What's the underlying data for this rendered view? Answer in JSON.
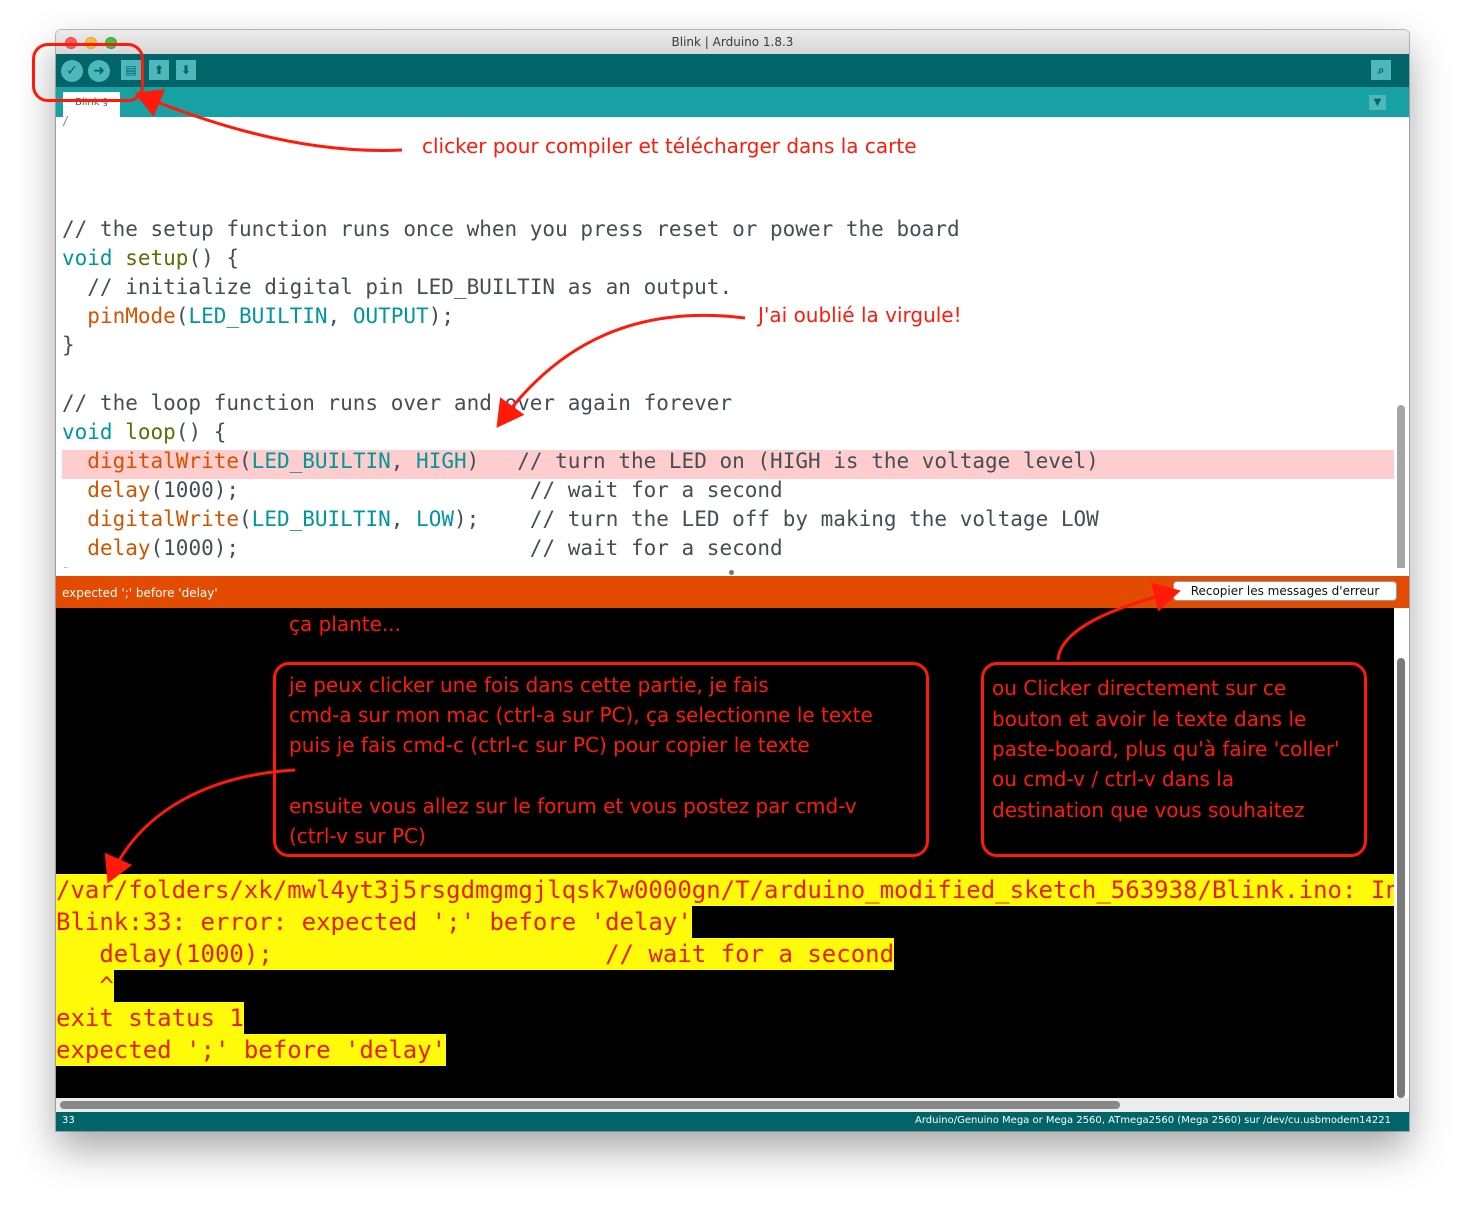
{
  "window": {
    "title": "Blink | Arduino 1.8.3"
  },
  "toolbar": {
    "verify_icon": "checkmark-icon",
    "upload_icon": "arrow-right-icon",
    "new_icon": "document-icon",
    "open_icon": "arrow-up-icon",
    "save_icon": "arrow-down-icon",
    "serial_icon": "magnifier-icon"
  },
  "tabs": [
    {
      "label": "Blink §"
    }
  ],
  "editor": {
    "lines": [
      "/",
      "",
      "// the setup function runs once when you press reset or power the board",
      "void setup() {",
      "  // initialize digital pin LED_BUILTIN as an output.",
      "  pinMode(LED_BUILTIN, OUTPUT);",
      "}",
      "",
      "// the loop function runs over and over again forever",
      "void loop() {",
      "  digitalWrite(LED_BUILTIN, HIGH)   // turn the LED on (HIGH is the voltage level)",
      "  delay(1000);                       // wait for a second",
      "  digitalWrite(LED_BUILTIN, LOW);    // turn the LED off by making the voltage LOW",
      "  delay(1000);                       // wait for a second",
      "}"
    ],
    "highlighted_line": 12
  },
  "error_bar": {
    "message": "expected ';' before 'delay'",
    "copy_button": "Recopier les messages d'erreur"
  },
  "console": {
    "lines": [
      "/var/folders/xk/mwl4yt3j5rsgdmgmgjlqsk7w0000gn/T/arduino_modified_sketch_563938/Blink.ino: In fu",
      "Blink:33: error: expected ';' before 'delay'",
      "   delay(1000);                       // wait for a second",
      "   ^",
      "exit status 1",
      "expected ';' before 'delay'"
    ]
  },
  "status_bar": {
    "line": "33",
    "board": "Arduino/Genuino Mega or Mega 2560, ATmega2560 (Mega 2560) sur /dev/cu.usbmodem14221"
  },
  "annotations": {
    "compile": "clicker pour compiler et télécharger dans la carte",
    "comma": "J'ai oublié la virgule!",
    "crash": "ça plante...",
    "select_text": [
      "je peux clicker une fois dans cette partie, je fais",
      "cmd-a sur mon mac (ctrl-a sur PC), ça selectionne le texte",
      "puis je fais cmd-c (ctrl-c sur PC) pour copier le texte",
      "",
      "ensuite vous allez sur le forum et vous postez par cmd-v",
      "(ctrl-v sur PC)"
    ],
    "click_button": [
      "ou Clicker directement sur ce",
      "bouton et avoir le texte dans le",
      "paste-board, plus qu'à faire 'coller'",
      "ou cmd-v / ctrl-v dans la",
      "destination que vous souhaitez"
    ]
  },
  "colors": {
    "toolbar": "#006468",
    "tabbar": "#17a1a5",
    "error_bar": "#e34c00",
    "annotation": "#ff1a0a",
    "console_highlight": "#fffa0a"
  }
}
